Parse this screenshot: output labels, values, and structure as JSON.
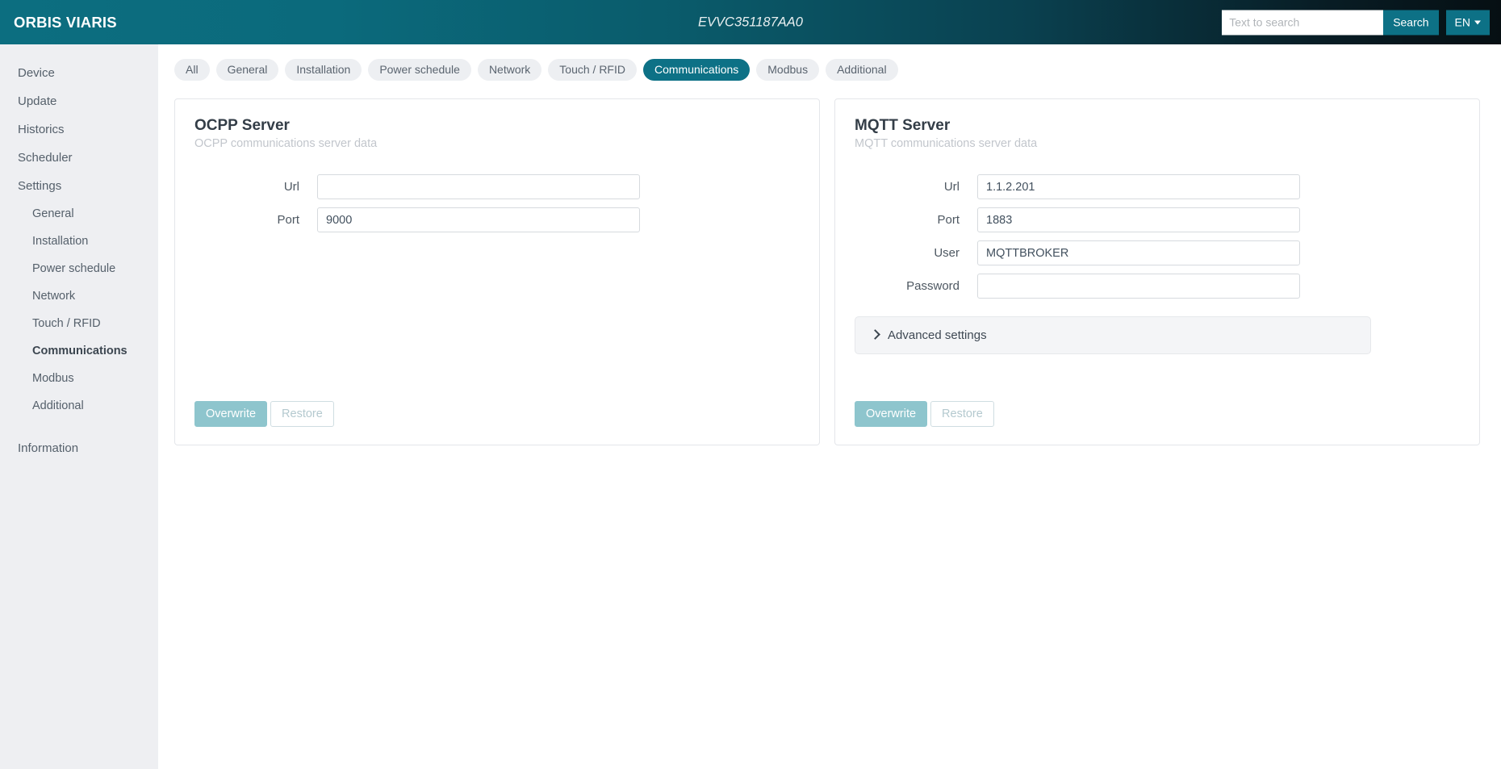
{
  "header": {
    "brand": "ORBIS VIARIS",
    "device_title": "EVVC351187AA0",
    "search": {
      "value": "",
      "placeholder": "Text to search",
      "button_label": "Search"
    },
    "language": {
      "label": "EN",
      "icon": "caret-down-icon"
    },
    "gradient_from": "#0c6e80",
    "gradient_to": "#060f13",
    "accent": "#0d7186"
  },
  "sidebar": {
    "items": [
      {
        "label": "Device",
        "level": 0,
        "active": false
      },
      {
        "label": "Update",
        "level": 0,
        "active": false
      },
      {
        "label": "Historics",
        "level": 0,
        "active": false
      },
      {
        "label": "Scheduler",
        "level": 0,
        "active": false
      },
      {
        "label": "Settings",
        "level": 0,
        "active": false
      },
      {
        "label": "General",
        "level": 1,
        "active": false
      },
      {
        "label": "Installation",
        "level": 1,
        "active": false
      },
      {
        "label": "Power schedule",
        "level": 1,
        "active": false
      },
      {
        "label": "Network",
        "level": 1,
        "active": false
      },
      {
        "label": "Touch / RFID",
        "level": 1,
        "active": false
      },
      {
        "label": "Communications",
        "level": 1,
        "active": true
      },
      {
        "label": "Modbus",
        "level": 1,
        "active": false
      },
      {
        "label": "Additional",
        "level": 1,
        "active": false
      },
      {
        "label": "Information",
        "level": 0,
        "active": false
      }
    ]
  },
  "tabs": [
    {
      "label": "All",
      "active": false
    },
    {
      "label": "General",
      "active": false
    },
    {
      "label": "Installation",
      "active": false
    },
    {
      "label": "Power schedule",
      "active": false
    },
    {
      "label": "Network",
      "active": false
    },
    {
      "label": "Touch / RFID",
      "active": false
    },
    {
      "label": "Communications",
      "active": true
    },
    {
      "label": "Modbus",
      "active": false
    },
    {
      "label": "Additional",
      "active": false
    }
  ],
  "ocpp_card": {
    "title": "OCPP Server",
    "subtitle": "OCPP communications server data",
    "fields": [
      {
        "label": "Url",
        "value": "",
        "placeholder": ""
      },
      {
        "label": "Port",
        "value": "9000",
        "placeholder": ""
      }
    ],
    "buttons": {
      "overwrite": "Overwrite",
      "restore": "Restore"
    }
  },
  "mqtt_card": {
    "title": "MQTT Server",
    "subtitle": "MQTT communications server data",
    "fields": [
      {
        "label": "Url",
        "value": "1.1.2.201",
        "placeholder": ""
      },
      {
        "label": "Port",
        "value": "1883",
        "placeholder": ""
      },
      {
        "label": "User",
        "value": "MQTTBROKER",
        "placeholder": ""
      },
      {
        "label": "Password",
        "value": "",
        "placeholder": ""
      }
    ],
    "advanced": {
      "label": "Advanced settings",
      "icon": "chevron-right-icon",
      "expanded": false
    },
    "buttons": {
      "overwrite": "Overwrite",
      "restore": "Restore"
    }
  }
}
